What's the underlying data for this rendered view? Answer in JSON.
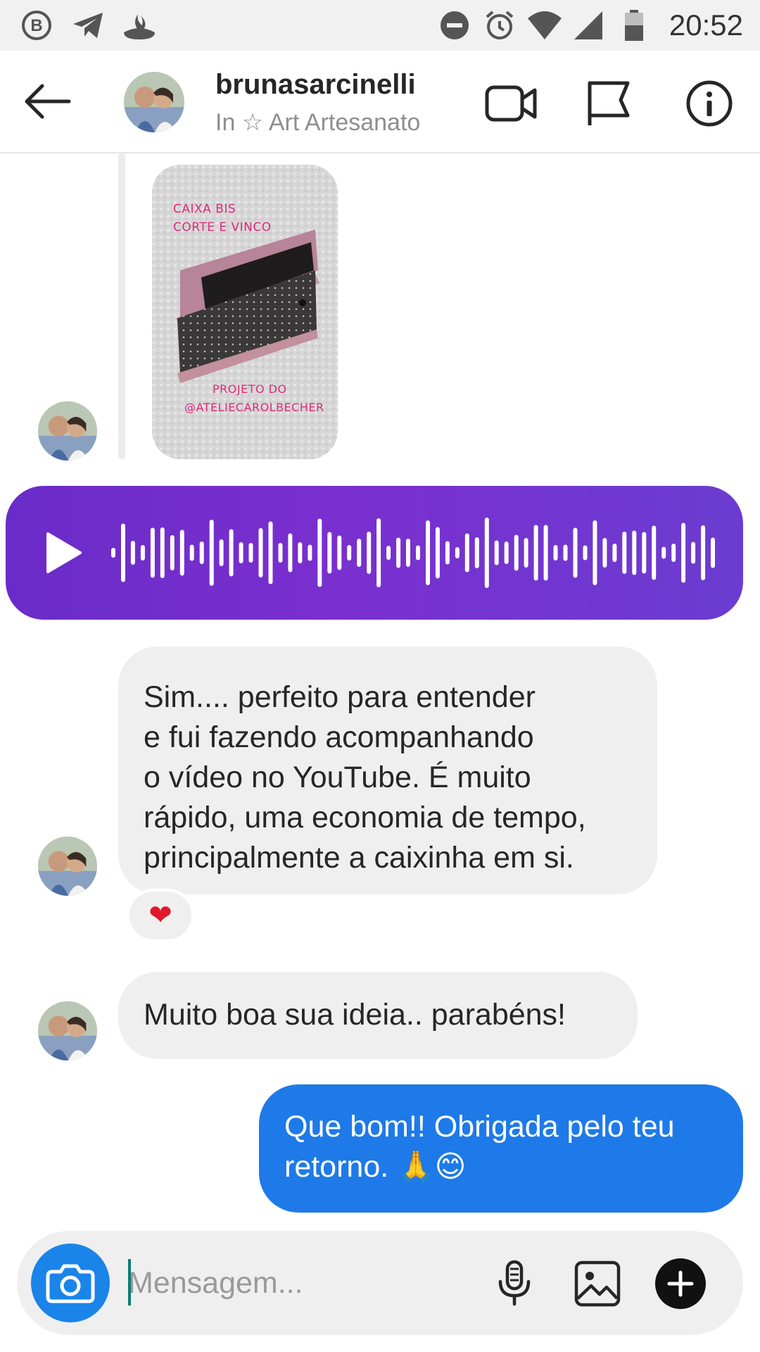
{
  "status_bar": {
    "time": "20:52",
    "left_icons": [
      "b-badge-icon",
      "telegram-icon",
      "santander-flame-icon"
    ],
    "right_icons": [
      "do-not-disturb-icon",
      "alarm-icon",
      "wifi-icon",
      "cell-signal-icon",
      "battery-icon"
    ]
  },
  "header": {
    "username": "brunasarcinelli",
    "subtitle": "In ☆ Art Artesanato",
    "icons": [
      "back-arrow-icon",
      "video-call-icon",
      "flag-icon",
      "info-icon"
    ]
  },
  "story_reply": {
    "title_lines": [
      "CAIXA BIS",
      "CORTE E VINCO"
    ],
    "credit_lines": [
      "PROJETO DO",
      "@ATELIECAROLBECHER"
    ]
  },
  "voice_message": {
    "icon": "play-icon",
    "accent_colors": [
      "#6a2cc8",
      "#6b3cd0"
    ]
  },
  "messages": [
    {
      "side": "incoming",
      "lines": [
        "Sim.... perfeito para entender",
        "e fui fazendo acompanhando",
        "o vídeo no YouTube. É muito",
        "rápido, uma economia de tempo,",
        "principalmente a caixinha em si."
      ],
      "reaction": "❤"
    },
    {
      "side": "incoming",
      "lines": [
        "Muito boa sua ideia.. parabéns!"
      ]
    },
    {
      "side": "outgoing",
      "lines": [
        "Que bom!! Obrigada pelo teu",
        "retorno. 🙏😊"
      ]
    }
  ],
  "composer": {
    "placeholder": "Mensagem...",
    "icons": [
      "camera-icon",
      "microphone-icon",
      "gallery-icon",
      "add-icon"
    ],
    "accent": "#1b84e8"
  },
  "colors": {
    "outgoing_bubble": "#1e7ae8",
    "incoming_bubble": "#efefef"
  }
}
